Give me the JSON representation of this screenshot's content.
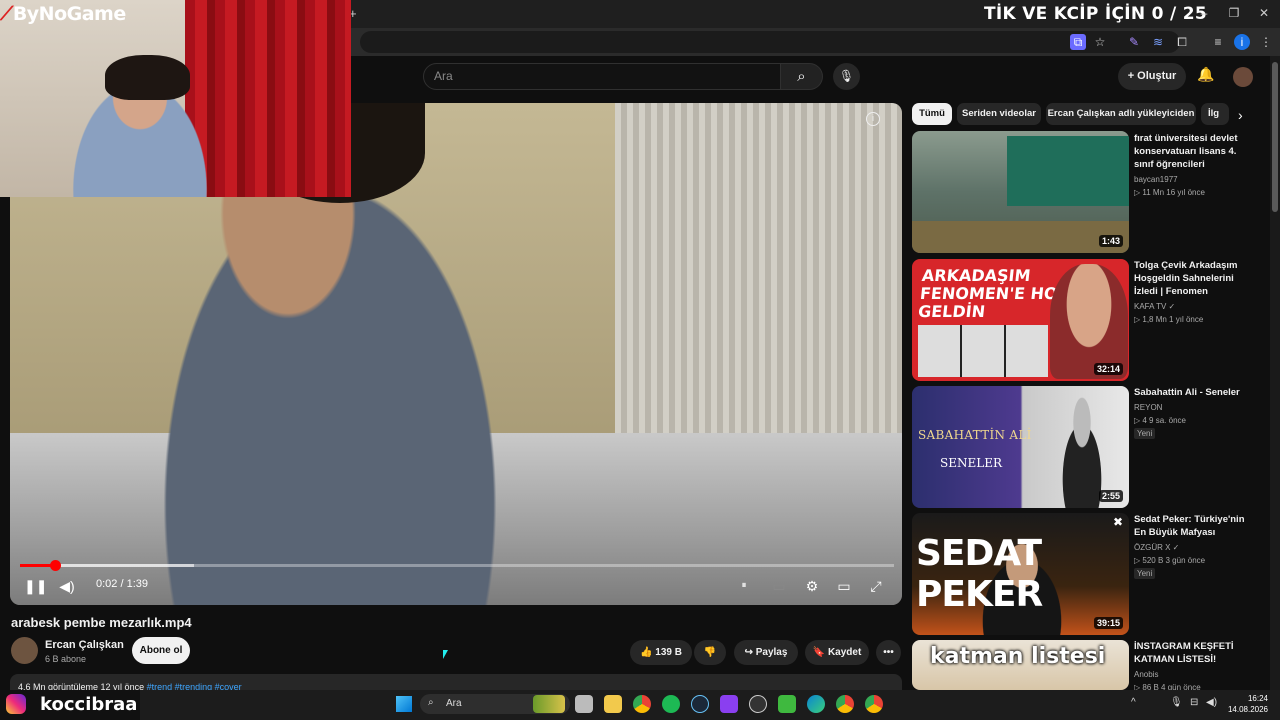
{
  "stream_overlay": {
    "logo": "ByNoGame",
    "counter": "TİK VE KCİP İÇİN 0 / 25",
    "instagram_handle": "koccibraa"
  },
  "header": {
    "search_placeholder": "Ara",
    "create_label": "Oluştur"
  },
  "player": {
    "time": "0:02 / 1:39",
    "progress": 0.02
  },
  "video": {
    "title": "arabesk pembe mezarlık.mp4",
    "channel": "Ercan Çalışkan",
    "subscribers": "6 B abone",
    "subscribe_label": "Abone ol",
    "likes": "139 B",
    "share_label": "Paylaş",
    "save_label": "Kaydet",
    "desc_views": "4,6 Mn görüntüleme  12 yıl önce",
    "desc_tags": "#trend #trending #cover"
  },
  "chips": [
    "Tümü",
    "Seriden videolar",
    "Ercan Çalışkan adlı yükleyiciden",
    "İlg"
  ],
  "recommendations": [
    {
      "title": "fırat üniversitesi devlet konservatuarı lisans 4. sınıf öğrencileri",
      "channel": "baycan1977",
      "meta": "▷ 11 Mn   16 yıl önce",
      "duration": "1:43"
    },
    {
      "title": "Tolga Çevik Arkadaşım Hoşgeldin Sahnelerini İzledi | Fenomen",
      "channel": "KAFA TV ✓",
      "meta": "▷ 1,8 Mn   1 yıl önce",
      "duration": "32:14",
      "thumb_text": "ARKADAŞIM FENOMEN'E HOŞ GELDİN"
    },
    {
      "title": "Sabahattin Ali - Seneler",
      "channel": "REYON",
      "meta": "▷ 4   9 sa. önce",
      "badge": "Yeni",
      "duration": "2:55",
      "thumb_text": "SABAHATTİN ALİ",
      "thumb_text2": "SENELER"
    },
    {
      "title": "Sedat Peker: Türkiye'nin En Büyük Mafyası",
      "channel": "ÖZGÜR X ✓",
      "meta": "▷ 520 B   3 gün önce",
      "badge": "Yeni",
      "duration": "39:15",
      "thumb_text": "SEDAT PEKER"
    },
    {
      "title": "İNSTAGRAM KEŞFETİ KATMAN LİSTESİ!",
      "channel": "Anobis",
      "meta": "▷ 86 B   4 gün önce",
      "thumb_text": "katman listesi"
    }
  ],
  "taskbar": {
    "search_label": "Ara",
    "time": "16:24",
    "date": "14.08.2026"
  }
}
